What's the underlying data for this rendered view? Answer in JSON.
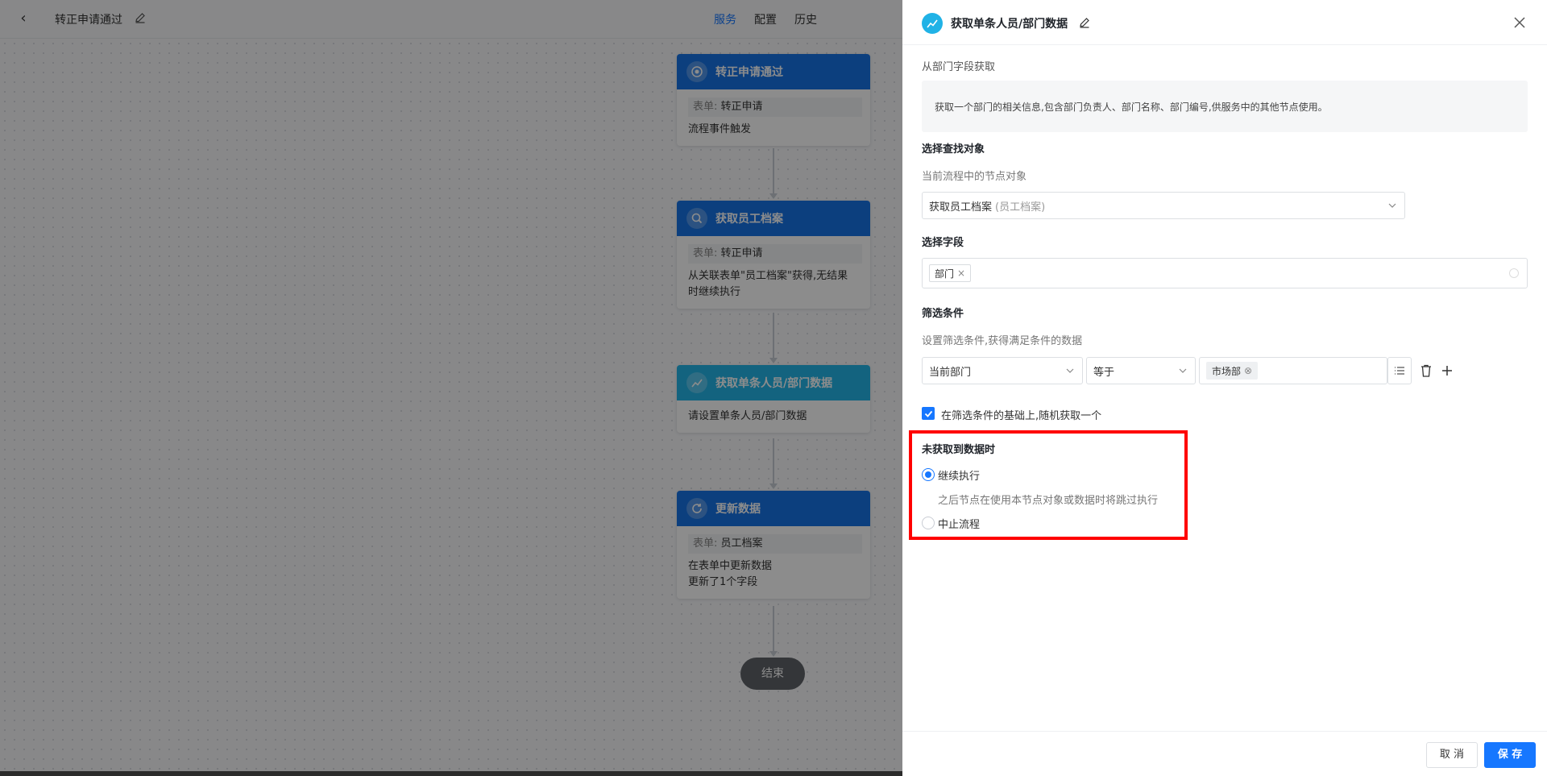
{
  "topbar": {
    "title": "转正申请通过",
    "tabs": [
      {
        "label": "服务",
        "active": true
      },
      {
        "label": "配置",
        "active": false
      },
      {
        "label": "历史",
        "active": false
      }
    ]
  },
  "flow": {
    "nodes": [
      {
        "title": "转正申请通过",
        "icon": "target-icon",
        "form_key": "表单:",
        "form_value": "转正申请",
        "lines": [
          "流程事件触发"
        ]
      },
      {
        "title": "获取员工档案",
        "icon": "search-icon",
        "form_key": "表单:",
        "form_value": "转正申请",
        "lines": [
          "从关联表单\"员工档案\"获得,无结果",
          "时继续执行"
        ]
      },
      {
        "title": "获取单条人员/部门数据",
        "icon": "chart-icon",
        "lines": [
          "请设置单条人员/部门数据"
        ]
      },
      {
        "title": "更新数据",
        "icon": "refresh-icon",
        "form_key": "表单:",
        "form_value": "员工档案",
        "lines": [
          "在表单中更新数据",
          "更新了1个字段"
        ]
      }
    ],
    "end_label": "结束"
  },
  "drawer": {
    "title": "获取单条人员/部门数据",
    "source_label": "从部门字段获取",
    "description": "获取一个部门的相关信息,包含部门负责人、部门名称、部门编号,供服务中的其他节点使用。",
    "target_section": {
      "title": "选择查找对象",
      "subtitle": "当前流程中的节点对象",
      "selected": "获取员工档案",
      "selected_hint": "(员工档案)"
    },
    "field_section": {
      "title": "选择字段",
      "tag": "部门"
    },
    "filter_section": {
      "title": "筛选条件",
      "subtitle": "设置筛选条件,获得满足条件的数据",
      "field": "当前部门",
      "operator": "等于",
      "value_tag": "市场部"
    },
    "random_checkbox": {
      "checked": true,
      "label": "在筛选条件的基础上,随机获取一个"
    },
    "no_data_section": {
      "title": "未获取到数据时",
      "options": [
        {
          "label": "继续执行",
          "selected": true
        },
        {
          "label": "中止流程",
          "selected": false
        }
      ],
      "continue_hint": "之后节点在使用本节点对象或数据时将跳过执行"
    },
    "footer": {
      "cancel_label": "取 消",
      "save_label": "保 存"
    }
  },
  "colors": {
    "primary": "#1677ff",
    "node_header": "#1773e6",
    "node_header_active": "#23b5e8",
    "highlight": "#ff0000"
  }
}
